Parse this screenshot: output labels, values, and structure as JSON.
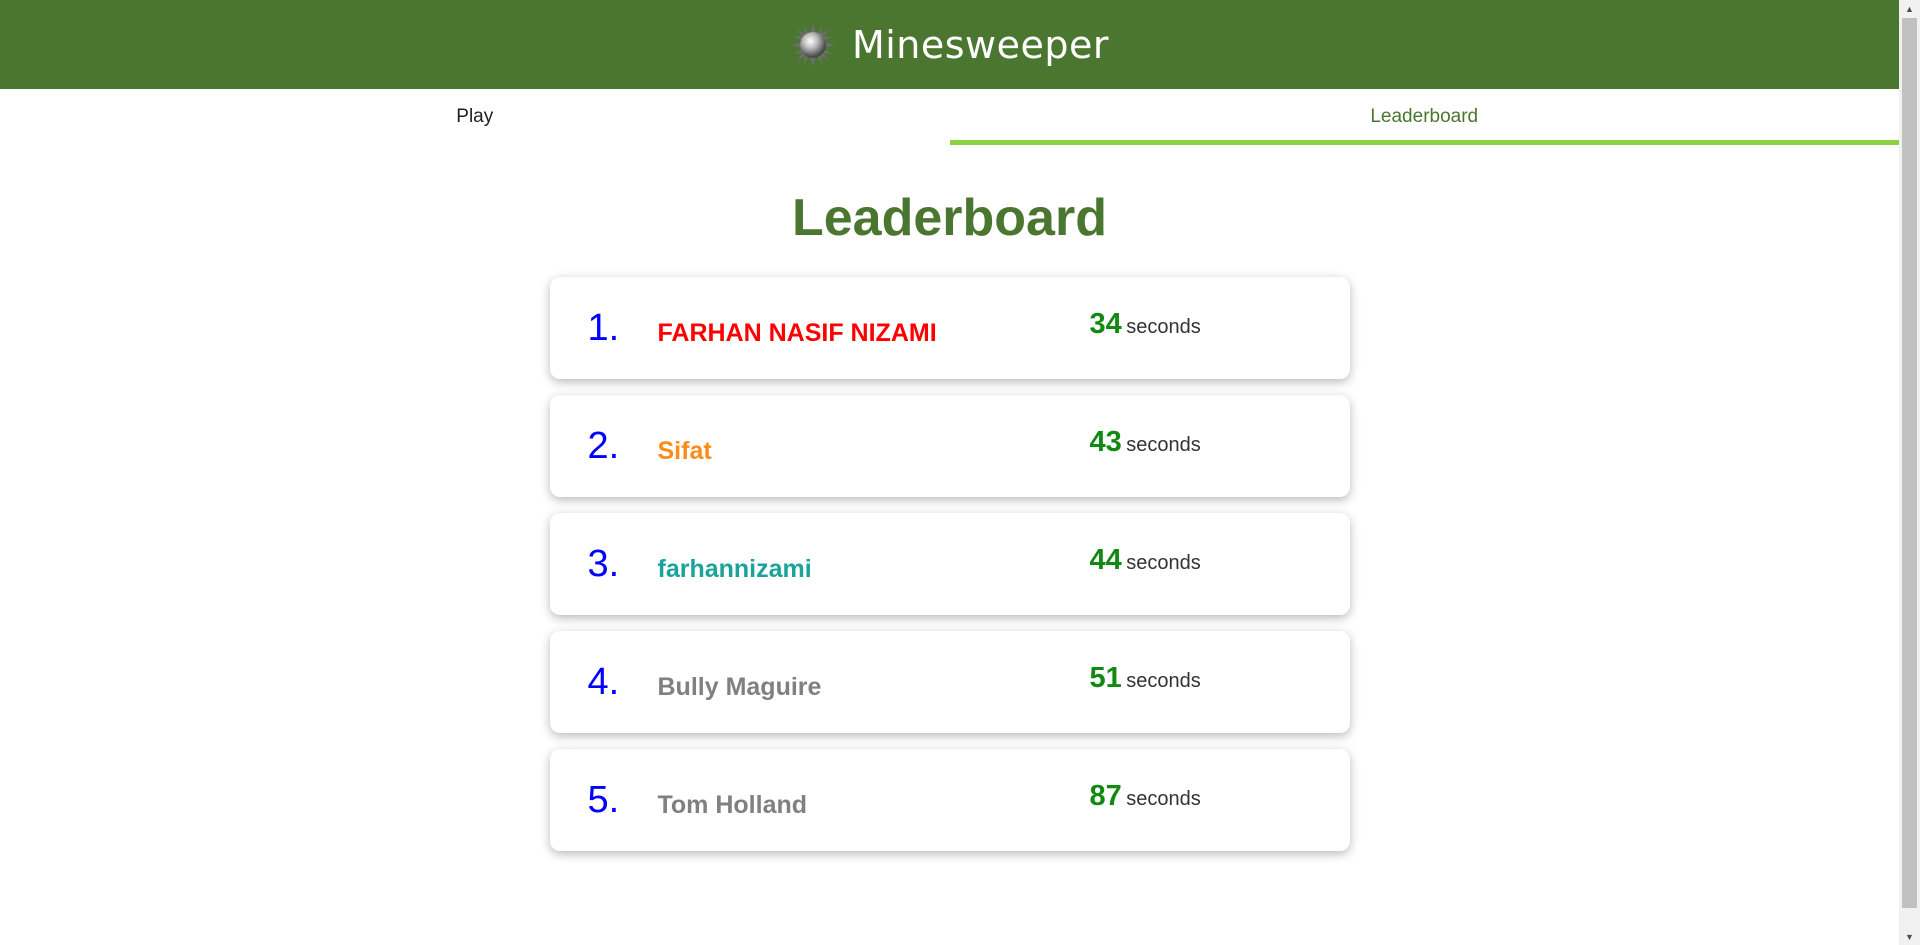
{
  "header": {
    "title": "Minesweeper",
    "icon": "mine-icon",
    "background_color": "#4a7630"
  },
  "tabs": [
    {
      "label": "Play",
      "active": false
    },
    {
      "label": "Leaderboard",
      "active": true
    }
  ],
  "page": {
    "title": "Leaderboard"
  },
  "leaderboard": [
    {
      "rank": "1.",
      "name": "FARHAN NASIF NIZAMI",
      "name_color": "#ff0000",
      "time": "34",
      "unit": "seconds"
    },
    {
      "rank": "2.",
      "name": "Sifat",
      "name_color": "#ff8c1a",
      "time": "43",
      "unit": "seconds"
    },
    {
      "rank": "3.",
      "name": "farhannizami",
      "name_color": "#1aa39a",
      "time": "44",
      "unit": "seconds"
    },
    {
      "rank": "4.",
      "name": "Bully Maguire",
      "name_color": "#808080",
      "time": "51",
      "unit": "seconds"
    },
    {
      "rank": "5.",
      "name": "Tom Holland",
      "name_color": "#808080",
      "time": "87",
      "unit": "seconds"
    }
  ],
  "colors": {
    "accent_green": "#4a7630",
    "tab_underline": "#8ed140",
    "rank_color": "#0000ff",
    "time_color": "#128a12"
  }
}
